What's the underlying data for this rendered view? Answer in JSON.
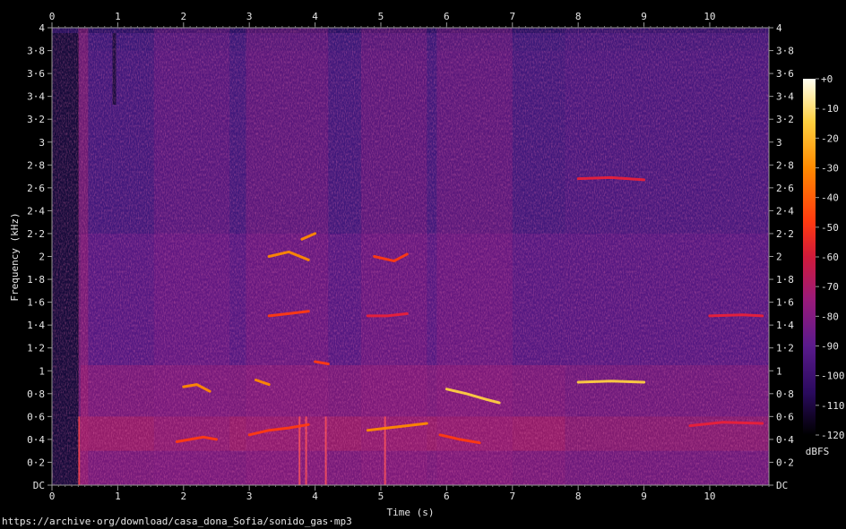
{
  "chart_data": {
    "type": "heatmap",
    "title": "",
    "xlabel": "Time (s)",
    "ylabel": "Frequency (kHz)",
    "xlim": [
      0,
      10.9
    ],
    "ylim": [
      0,
      4
    ],
    "x_ticks": [
      "0",
      "1",
      "2",
      "3",
      "4",
      "5",
      "6",
      "7",
      "8",
      "9",
      "10"
    ],
    "y_ticks": [
      "DC",
      "0·2",
      "0·4",
      "0·6",
      "0·8",
      "1",
      "1·2",
      "1·4",
      "1·6",
      "1·8",
      "2",
      "2·2",
      "2·4",
      "2·6",
      "2·8",
      "3",
      "3·2",
      "3·4",
      "3·6",
      "3·8",
      "4"
    ],
    "colorbar": {
      "unit": "dBFS",
      "range": [
        -120,
        0
      ],
      "ticks": [
        "+0",
        "-10",
        "-20",
        "-30",
        "-40",
        "-50",
        "-60",
        "-70",
        "-80",
        "-90",
        "-100",
        "-110",
        "-120"
      ],
      "colors": [
        "#000000",
        "#2a0a5e",
        "#5a1a8c",
        "#9a1a7a",
        "#d01a3a",
        "#ff3a10",
        "#ff8a00",
        "#ffd040",
        "#fffff0"
      ]
    },
    "background_colors": {
      "base": "#3a1878",
      "mid": "#7a1a88",
      "bright": "#e83050"
    },
    "harmonic_traces": [
      {
        "t": [
          1.9,
          2.1,
          2.3,
          2.5
        ],
        "khz": [
          0.38,
          0.4,
          0.42,
          0.4
        ],
        "level_db": -45
      },
      {
        "t": [
          3.0,
          3.3,
          3.6,
          3.9
        ],
        "khz": [
          0.44,
          0.48,
          0.5,
          0.53
        ],
        "level_db": -45
      },
      {
        "t": [
          3.3,
          3.6,
          3.9
        ],
        "khz": [
          2.0,
          2.04,
          1.97
        ],
        "level_db": -40
      },
      {
        "t": [
          3.3,
          3.6,
          3.9
        ],
        "khz": [
          1.48,
          1.5,
          1.52
        ],
        "level_db": -45
      },
      {
        "t": [
          2.0,
          2.2,
          2.4
        ],
        "khz": [
          0.86,
          0.88,
          0.82
        ],
        "level_db": -42
      },
      {
        "t": [
          3.1,
          3.3
        ],
        "khz": [
          0.92,
          0.88
        ],
        "level_db": -40
      },
      {
        "t": [
          3.8,
          4.0
        ],
        "khz": [
          2.15,
          2.2
        ],
        "level_db": -40
      },
      {
        "t": [
          4.8,
          5.1,
          5.4,
          5.7
        ],
        "khz": [
          0.48,
          0.5,
          0.52,
          0.54
        ],
        "level_db": -40
      },
      {
        "t": [
          4.9,
          5.2,
          5.4
        ],
        "khz": [
          2.0,
          1.96,
          2.02
        ],
        "level_db": -45
      },
      {
        "t": [
          6.0,
          6.3,
          6.6,
          6.8
        ],
        "khz": [
          0.84,
          0.8,
          0.75,
          0.72
        ],
        "level_db": -38
      },
      {
        "t": [
          5.9,
          6.2,
          6.5
        ],
        "khz": [
          0.44,
          0.4,
          0.37
        ],
        "level_db": -45
      },
      {
        "t": [
          8.0,
          8.5,
          9.0
        ],
        "khz": [
          0.9,
          0.91,
          0.9
        ],
        "level_db": -35
      },
      {
        "t": [
          8.0,
          8.5,
          9.0
        ],
        "khz": [
          2.68,
          2.69,
          2.67
        ],
        "level_db": -48
      },
      {
        "t": [
          9.7,
          10.2,
          10.8
        ],
        "khz": [
          0.52,
          0.55,
          0.54
        ],
        "level_db": -48
      },
      {
        "t": [
          10.0,
          10.5,
          10.8
        ],
        "khz": [
          1.48,
          1.49,
          1.48
        ],
        "level_db": -50
      },
      {
        "t": [
          4.0,
          4.2
        ],
        "khz": [
          1.08,
          1.06
        ],
        "level_db": -45
      },
      {
        "t": [
          4.8,
          5.1,
          5.4
        ],
        "khz": [
          1.48,
          1.48,
          1.5
        ],
        "level_db": -50
      }
    ],
    "source_url": "https://archive·org/download/casa_dona_Sofia/sonido_gas·mp3"
  }
}
